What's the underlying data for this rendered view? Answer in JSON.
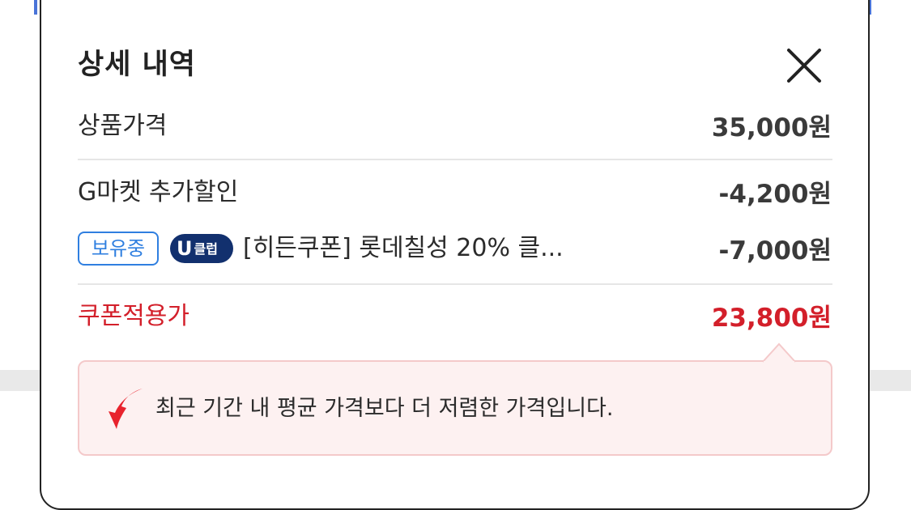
{
  "modal": {
    "title": "상세 내역"
  },
  "rows": {
    "product_price": {
      "label": "상품가격",
      "value": "35,000원"
    },
    "gmarket_discount": {
      "label": "G마켓 추가할인",
      "value": "-4,200원"
    },
    "coupon": {
      "owned_badge": "보유중",
      "club_badge_mark": "U",
      "club_badge_text": "클럽",
      "name": "[히든쿠폰] 롯데칠성 20% 클...",
      "value": "-7,000원"
    },
    "coupon_price": {
      "label": "쿠폰적용가",
      "value": "23,800원"
    }
  },
  "notice": {
    "text": "최근 기간 내 평균 가격보다 더 저렴한 가격입니다.",
    "icon": "red-down-arrow-icon"
  },
  "colors": {
    "accent_red": "#d31f2a",
    "badge_blue": "#2f7fe0",
    "club_navy": "#12306e",
    "notice_bg": "#fdf1f1"
  }
}
